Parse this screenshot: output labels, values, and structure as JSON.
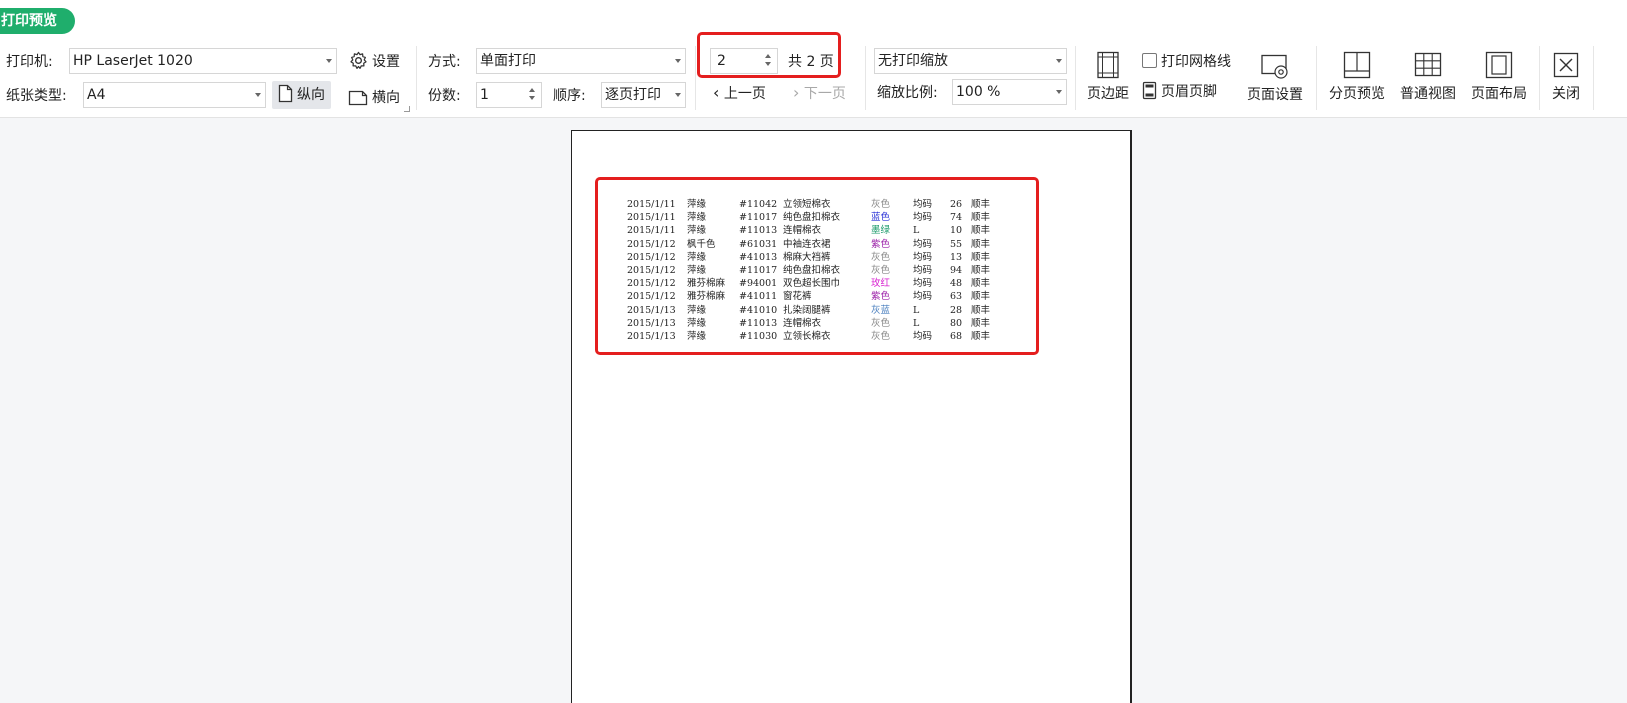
{
  "app": {
    "tab_title": "打印预览"
  },
  "printer": {
    "label": "打印机:",
    "value": "HP LaserJet 1020",
    "settings_label": "设置"
  },
  "paper": {
    "label": "纸张类型:",
    "value": "A4",
    "portrait_label": "纵向",
    "landscape_label": "横向"
  },
  "mode": {
    "label": "方式:",
    "value": "单面打印"
  },
  "copies": {
    "label": "份数:",
    "value": "1",
    "order_label": "顺序:",
    "order_value": "逐页打印"
  },
  "pager": {
    "current": "2",
    "total_text": "共 2 页",
    "prev_label": "上一页",
    "next_label": "下一页"
  },
  "scale": {
    "fit_value": "无打印缩放",
    "ratio_label": "缩放比例:",
    "ratio_value": "100 %"
  },
  "options": {
    "gridlines_label": "打印网格线",
    "gridlines_checked": false,
    "header_footer_label": "页眉页脚"
  },
  "ribbon": {
    "margins_label": "页边距",
    "page_setup_label": "页面设置",
    "page_break_label": "分页预览",
    "normal_view_label": "普通视图",
    "page_layout_label": "页面布局",
    "close_label": "关闭"
  },
  "colors": {
    "accent_green": "#1fae6c",
    "highlight_red": "#e41e1e"
  },
  "table": {
    "rows": [
      {
        "date": "2015/1/11",
        "brand": "萍缘",
        "code": "#11042",
        "name": "立领短棉衣",
        "color": "灰色",
        "color_hex": "#888888",
        "size": "均码",
        "qty": "26",
        "ship": "顺丰"
      },
      {
        "date": "2015/1/11",
        "brand": "萍缘",
        "code": "#11017",
        "name": "纯色盘扣棉衣",
        "color": "蓝色",
        "color_hex": "#2a32d6",
        "size": "均码",
        "qty": "74",
        "ship": "顺丰"
      },
      {
        "date": "2015/1/11",
        "brand": "萍缘",
        "code": "#11013",
        "name": "连帽棉衣",
        "color": "墨绿",
        "color_hex": "#1a9a6a",
        "size": "L",
        "qty": "10",
        "ship": "顺丰"
      },
      {
        "date": "2015/1/12",
        "brand": "枫千色",
        "code": "#61031",
        "name": "中袖连衣裙",
        "color": "紫色",
        "color_hex": "#9b1fa8",
        "size": "均码",
        "qty": "55",
        "ship": "顺丰"
      },
      {
        "date": "2015/1/12",
        "brand": "萍缘",
        "code": "#41013",
        "name": "棉麻大裆裤",
        "color": "灰色",
        "color_hex": "#888888",
        "size": "均码",
        "qty": "13",
        "ship": "顺丰"
      },
      {
        "date": "2015/1/12",
        "brand": "萍缘",
        "code": "#11017",
        "name": "纯色盘扣棉衣",
        "color": "灰色",
        "color_hex": "#888888",
        "size": "均码",
        "qty": "94",
        "ship": "顺丰"
      },
      {
        "date": "2015/1/12",
        "brand": "雅芬棉麻",
        "code": "#94001",
        "name": "双色超长围巾",
        "color": "玫红",
        "color_hex": "#d81fd0",
        "size": "均码",
        "qty": "48",
        "ship": "顺丰"
      },
      {
        "date": "2015/1/12",
        "brand": "雅芬棉麻",
        "code": "#41011",
        "name": "窗花裤",
        "color": "紫色",
        "color_hex": "#9b1fa8",
        "size": "均码",
        "qty": "63",
        "ship": "顺丰"
      },
      {
        "date": "2015/1/13",
        "brand": "萍缘",
        "code": "#41010",
        "name": "扎染阔腿裤",
        "color": "灰蓝",
        "color_hex": "#4a7fbf",
        "size": "L",
        "qty": "28",
        "ship": "顺丰"
      },
      {
        "date": "2015/1/13",
        "brand": "萍缘",
        "code": "#11013",
        "name": "连帽棉衣",
        "color": "灰色",
        "color_hex": "#888888",
        "size": "L",
        "qty": "80",
        "ship": "顺丰"
      },
      {
        "date": "2015/1/13",
        "brand": "萍缘",
        "code": "#11030",
        "name": "立领长棉衣",
        "color": "灰色",
        "color_hex": "#888888",
        "size": "均码",
        "qty": "68",
        "ship": "顺丰"
      }
    ]
  }
}
